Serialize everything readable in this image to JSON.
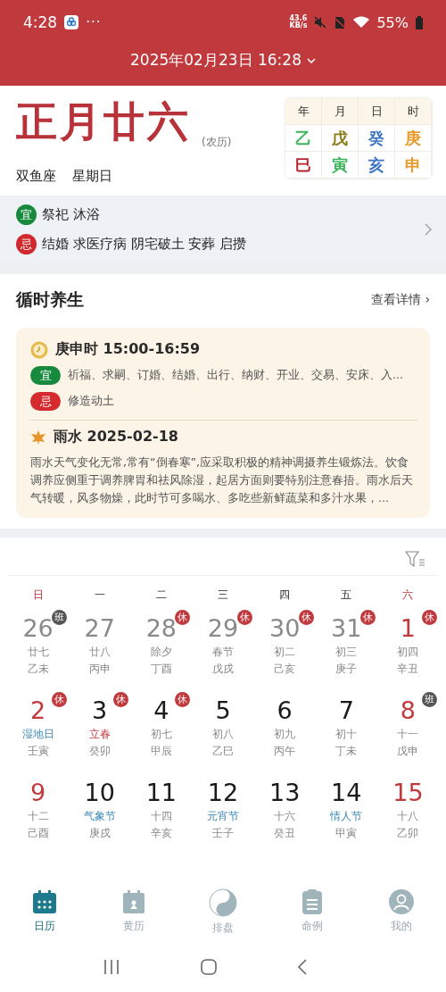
{
  "status_bar": {
    "time": "4:28",
    "more": "···",
    "speed_value": "43.6",
    "speed_unit": "KB/s",
    "battery": "55%"
  },
  "header": {
    "date": "2025年02月23日 16:28"
  },
  "day": {
    "lunar_date": "正月廿六",
    "lunar_note": "(农历)",
    "constellation": "双鱼座",
    "weekday": "星期日",
    "pillars": {
      "headers": [
        "年",
        "月",
        "日",
        "时"
      ],
      "stems": [
        {
          "text": "乙",
          "color": "#3cb55a"
        },
        {
          "text": "戊",
          "color": "#8a7d1a"
        },
        {
          "text": "癸",
          "color": "#3d74c4"
        },
        {
          "text": "庚",
          "color": "#e89a2a"
        }
      ],
      "branches": [
        {
          "text": "巳",
          "color": "#b8232d"
        },
        {
          "text": "寅",
          "color": "#3cb55a"
        },
        {
          "text": "亥",
          "color": "#3d74c4"
        },
        {
          "text": "申",
          "color": "#e89a2a"
        }
      ]
    }
  },
  "almanac": [
    {
      "kind": "yi",
      "badge": "宜",
      "text": "祭祀 沐浴"
    },
    {
      "kind": "ji",
      "badge": "忌",
      "text": "结婚 求医疗病 阴宅破土 安葬 启攒"
    }
  ],
  "health": {
    "title": "循时养生",
    "more": "查看详情 ›",
    "hour": {
      "title": "庚申时 15:00-16:59",
      "items": [
        {
          "kind": "yi",
          "badge": "宜",
          "text": "祈福、求嗣、订婚、结婚、出行、纳财、开业、交易、安床、入..."
        },
        {
          "kind": "ji",
          "badge": "忌",
          "text": "修造动土"
        }
      ]
    },
    "term": {
      "title": "雨水 2025-02-18",
      "text": "雨水天气变化无常,常有“倒春寒”,应采取积极的精神调摄养生锻炼法。饮食调养应侧重于调养脾胃和祛风除湿，起居方面则要特别注意春捂。雨水后天气转暖，风多物燥，此时节可多喝水、多吃些新鲜蔬菜和多汁水果，..."
    }
  },
  "calendar": {
    "weekdays": [
      "日",
      "一",
      "二",
      "三",
      "四",
      "五",
      "六"
    ],
    "weeks": [
      [
        {
          "num": "26",
          "other_month": true,
          "weekend": true,
          "kind": "lunar",
          "label": "廿七",
          "ganzhi": "乙未",
          "badge": {
            "text": "班",
            "kind": "work"
          }
        },
        {
          "num": "27",
          "other_month": true,
          "weekend": false,
          "kind": "lunar",
          "label": "廿八",
          "ganzhi": "丙申"
        },
        {
          "num": "28",
          "other_month": true,
          "weekend": false,
          "kind": "lunar",
          "label": "除夕",
          "ganzhi": "丁酉",
          "badge": {
            "text": "休",
            "kind": "rest"
          }
        },
        {
          "num": "29",
          "other_month": true,
          "weekend": false,
          "kind": "lunar",
          "label": "春节",
          "ganzhi": "戊戌",
          "badge": {
            "text": "休",
            "kind": "rest"
          }
        },
        {
          "num": "30",
          "other_month": true,
          "weekend": false,
          "kind": "lunar",
          "label": "初二",
          "ganzhi": "己亥",
          "badge": {
            "text": "休",
            "kind": "rest"
          }
        },
        {
          "num": "31",
          "other_month": true,
          "weekend": false,
          "kind": "lunar",
          "label": "初三",
          "ganzhi": "庚子",
          "badge": {
            "text": "休",
            "kind": "rest"
          }
        },
        {
          "num": "1",
          "other_month": false,
          "weekend": true,
          "kind": "lunar",
          "label": "初四",
          "ganzhi": "辛丑",
          "badge": {
            "text": "休",
            "kind": "rest"
          }
        }
      ],
      [
        {
          "num": "2",
          "other_month": false,
          "weekend": true,
          "kind": "festival",
          "label": "湿地日",
          "ganzhi": "壬寅",
          "badge": {
            "text": "休",
            "kind": "rest"
          }
        },
        {
          "num": "3",
          "other_month": false,
          "weekend": false,
          "kind": "term",
          "label": "立春",
          "ganzhi": "癸卯",
          "badge": {
            "text": "休",
            "kind": "rest"
          }
        },
        {
          "num": "4",
          "other_month": false,
          "weekend": false,
          "kind": "lunar",
          "label": "初七",
          "ganzhi": "甲辰",
          "badge": {
            "text": "休",
            "kind": "rest"
          }
        },
        {
          "num": "5",
          "other_month": false,
          "weekend": false,
          "kind": "lunar",
          "label": "初八",
          "ganzhi": "乙巳"
        },
        {
          "num": "6",
          "other_month": false,
          "weekend": false,
          "kind": "lunar",
          "label": "初九",
          "ganzhi": "丙午"
        },
        {
          "num": "7",
          "other_month": false,
          "weekend": false,
          "kind": "lunar",
          "label": "初十",
          "ganzhi": "丁未"
        },
        {
          "num": "8",
          "other_month": false,
          "weekend": true,
          "kind": "lunar",
          "label": "十一",
          "ganzhi": "戊申",
          "badge": {
            "text": "班",
            "kind": "work"
          }
        }
      ],
      [
        {
          "num": "9",
          "other_month": false,
          "weekend": true,
          "kind": "lunar",
          "label": "十二",
          "ganzhi": "己酉"
        },
        {
          "num": "10",
          "other_month": false,
          "weekend": false,
          "kind": "festival",
          "label": "气象节",
          "ganzhi": "庚戌"
        },
        {
          "num": "11",
          "other_month": false,
          "weekend": false,
          "kind": "lunar",
          "label": "十四",
          "ganzhi": "辛亥"
        },
        {
          "num": "12",
          "other_month": false,
          "weekend": false,
          "kind": "festival",
          "label": "元宵节",
          "ganzhi": "壬子"
        },
        {
          "num": "13",
          "other_month": false,
          "weekend": false,
          "kind": "lunar",
          "label": "十六",
          "ganzhi": "癸丑"
        },
        {
          "num": "14",
          "other_month": false,
          "weekend": false,
          "kind": "festival",
          "label": "情人节",
          "ganzhi": "甲寅"
        },
        {
          "num": "15",
          "other_month": false,
          "weekend": true,
          "kind": "lunar",
          "label": "十八",
          "ganzhi": "乙卯"
        }
      ]
    ]
  },
  "tab_bar": [
    {
      "kind": "calendar",
      "label": "日历",
      "selected": true
    },
    {
      "kind": "almanac",
      "label": "黄历",
      "selected": false
    },
    {
      "kind": "yinyang",
      "label": "排盘",
      "selected": false
    },
    {
      "kind": "clipboard",
      "label": "命例",
      "selected": false
    },
    {
      "kind": "profile",
      "label": "我的",
      "selected": false
    }
  ]
}
